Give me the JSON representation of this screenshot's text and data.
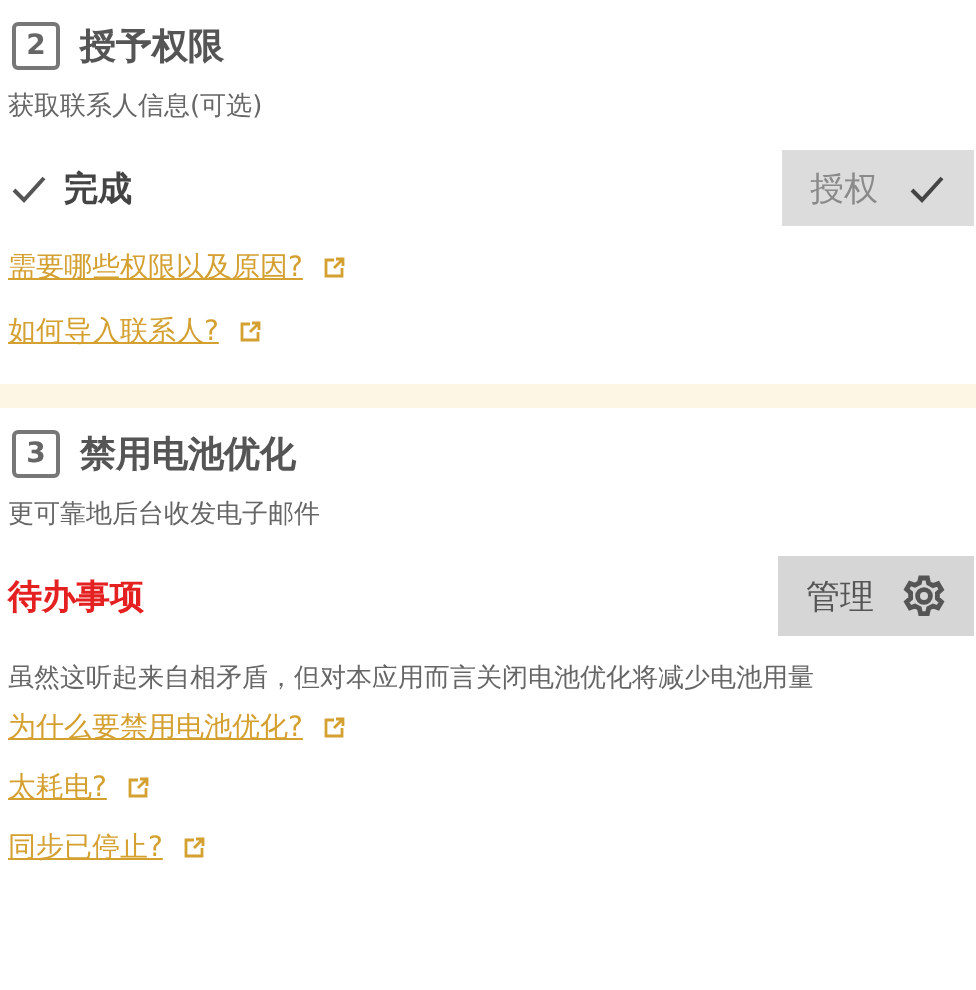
{
  "sections": [
    {
      "step": "2",
      "title": "授予权限",
      "subtitle": "获取联系人信息(可选)",
      "status": {
        "kind": "done",
        "label": "完成"
      },
      "button": {
        "kind": "grant",
        "label": "授权",
        "disabled": true
      },
      "links": [
        "需要哪些权限以及原因?",
        "如何导入联系人?"
      ]
    },
    {
      "step": "3",
      "title": "禁用电池优化",
      "subtitle": "更可靠地后台收发电子邮件",
      "status": {
        "kind": "todo",
        "label": "待办事项"
      },
      "button": {
        "kind": "manage",
        "label": "管理",
        "disabled": false
      },
      "note": "虽然这听起来自相矛盾，但对本应用而言关闭电池优化将减少电池用量",
      "links": [
        "为什么要禁用电池优化?",
        "太耗电?",
        "同步已停止?"
      ]
    }
  ]
}
